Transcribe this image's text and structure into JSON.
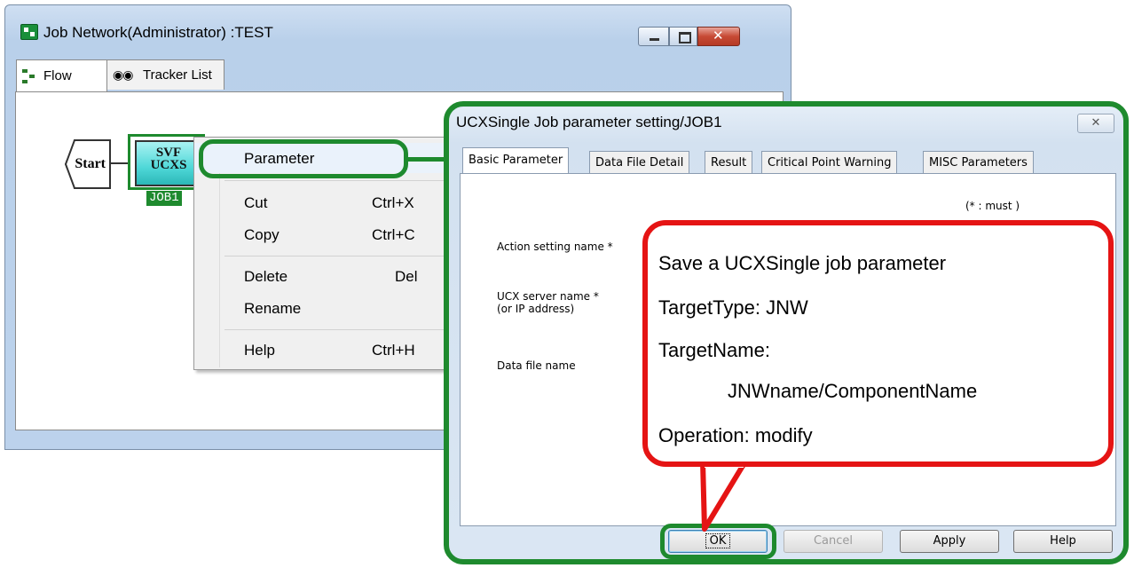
{
  "job_network_window": {
    "title": "Job Network(Administrator) :TEST",
    "tabs": [
      {
        "label": "Flow",
        "icon": "flow-icon"
      },
      {
        "label": "Tracker List",
        "icon": "tracker-icon"
      }
    ]
  },
  "flow": {
    "start_label": "Start",
    "job_icon_line1": "SVF",
    "job_icon_line2": "UCXS",
    "job_name": "JOB1"
  },
  "context_menu": {
    "items": [
      {
        "label": "Parameter",
        "shortcut": ""
      },
      {
        "label": "Cut",
        "shortcut": "Ctrl+X"
      },
      {
        "label": "Copy",
        "shortcut": "Ctrl+C"
      },
      {
        "label": "Delete",
        "shortcut": "Del"
      },
      {
        "label": "Rename",
        "shortcut": ""
      },
      {
        "label": "Help",
        "shortcut": "Ctrl+H"
      }
    ]
  },
  "dialog": {
    "title": "UCXSingle Job parameter setting/JOB1",
    "close_glyph": "✕",
    "tabs": [
      "Basic Parameter",
      "Data File Detail",
      "Result",
      "Critical Point Warning",
      "MISC Parameters"
    ],
    "must_note": "(* : must )",
    "fields": {
      "action_setting_name": "Action setting name  *",
      "ucx_server_name": "UCX server name  *",
      "ucx_server_name_sub": "(or IP address)",
      "data_file_name": "Data file name"
    },
    "buttons": {
      "ok": "OK",
      "cancel": "Cancel",
      "apply": "Apply",
      "help": "Help"
    }
  },
  "callout": {
    "line1": "Save a UCXSingle job parameter",
    "line2": "TargetType: JNW",
    "line3": "TargetName:",
    "line4": "JNWname/ComponentName",
    "line5": "Operation: modify"
  },
  "colors": {
    "highlight_green": "#1e8a2e",
    "callout_red": "#e51414",
    "job_node_cyan": "#4fd8d8"
  }
}
